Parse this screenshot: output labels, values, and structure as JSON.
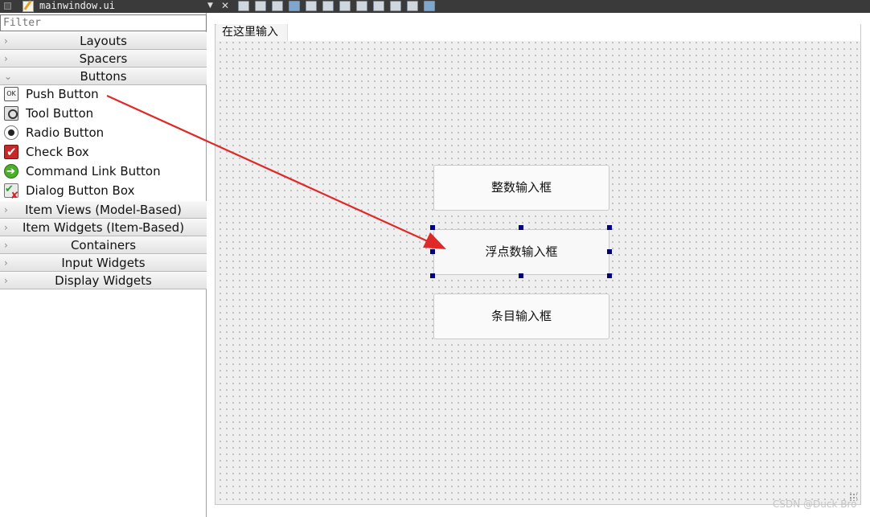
{
  "titlebar": {
    "filename": "mainwindow.ui",
    "dropdown_glyph": "▼",
    "close_glyph": "✕",
    "tool_icons": [
      "edit-widgets-icon",
      "edit-signals-icon",
      "edit-buddies-icon",
      "edit-tab-order-icon",
      "layout-horizontal-icon",
      "layout-vertical-icon",
      "layout-hsplitter-icon",
      "layout-vsplitter-icon",
      "layout-grid-icon",
      "layout-form-icon",
      "break-layout-icon",
      "adjust-size-icon"
    ]
  },
  "widget_box": {
    "filter_placeholder": "Filter",
    "categories": {
      "layouts": "Layouts",
      "spacers": "Spacers",
      "buttons": "Buttons",
      "item_views": "Item Views (Model-Based)",
      "item_widgets": "Item Widgets (Item-Based)",
      "containers": "Containers",
      "input_widgets": "Input Widgets",
      "display_widgets": "Display Widgets"
    },
    "collapsed_glyph": "›",
    "expanded_glyph": "⌄",
    "button_items": {
      "push_button": "Push Button",
      "tool_button": "Tool Button",
      "radio_button": "Radio Button",
      "check_box": "Check Box",
      "command_link_button": "Command Link Button",
      "dialog_button_box": "Dialog Button Box"
    },
    "ok_icon_text": "OK"
  },
  "form": {
    "menu_item": "在这里输入",
    "buttons": {
      "integer": "整数输入框",
      "float": "浮点数输入框",
      "item": "条目输入框"
    }
  },
  "annotation": {
    "arrow_color": "#e02828"
  },
  "watermark": "CSDN @Duck Bro"
}
